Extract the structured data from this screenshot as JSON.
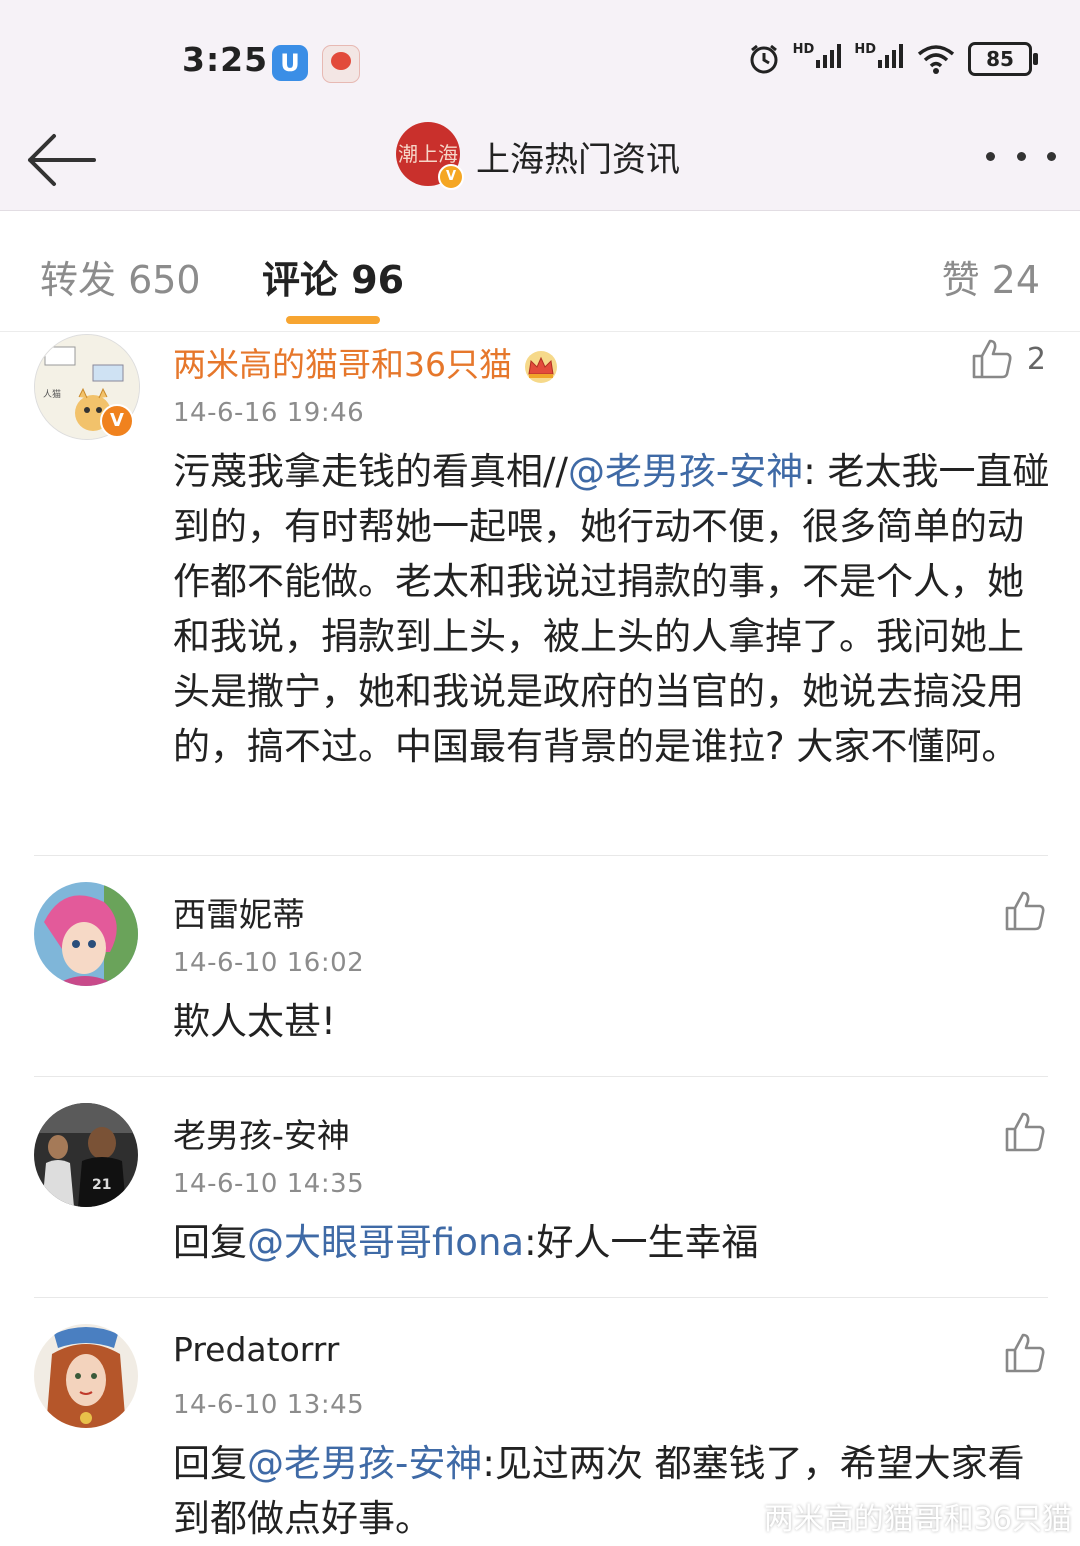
{
  "status_bar": {
    "time": "3:25",
    "network_1": "HD",
    "network_2": "HD",
    "battery": "85"
  },
  "header": {
    "account_name": "上海热门资讯",
    "avatar_text": "潮上海"
  },
  "tabs": [
    {
      "label": "转发 650"
    },
    {
      "label": "评论 96"
    },
    {
      "label": "赞 24"
    }
  ],
  "comments": [
    {
      "name": "两米高的猫哥和36只猫",
      "time": "14-6-16 19:46",
      "likes": "2",
      "text_prefix": "污蔑我拿走钱的看真相//",
      "mention": "@老男孩-安神",
      "text_suffix": ": 老太我一直碰到的，有时帮她一起喂，她行动不便，很多简单的动作都不能做。老太和我说过捐款的事，不是个人，她和我说，捐款到上头，被上头的人拿掉了。我问她上头是撒宁，她和我说是政府的当官的，她说去搞没用的，搞不过。中国最有背景的是谁拉? 大家不懂阿。"
    },
    {
      "name": "西雷妮蒂",
      "time": "14-6-10 16:02",
      "text": "欺人太甚!"
    },
    {
      "name": "老男孩-安神",
      "time": "14-6-10 14:35",
      "text_prefix": "回复",
      "mention": "@大眼哥哥fiona",
      "text_suffix": ":好人一生幸福"
    },
    {
      "name": "Predatorrr",
      "time": "14-6-10 13:45",
      "text_prefix": "回复",
      "mention": "@老男孩-安神",
      "text_suffix": ":见过两次 都塞钱了，希望大家看到都做点好事。"
    }
  ],
  "watermark": "两米高的猫哥和36只猫",
  "colors": {
    "accent": "#f7a531",
    "vip_name": "#e6772b",
    "mention": "#3f6aa6"
  }
}
